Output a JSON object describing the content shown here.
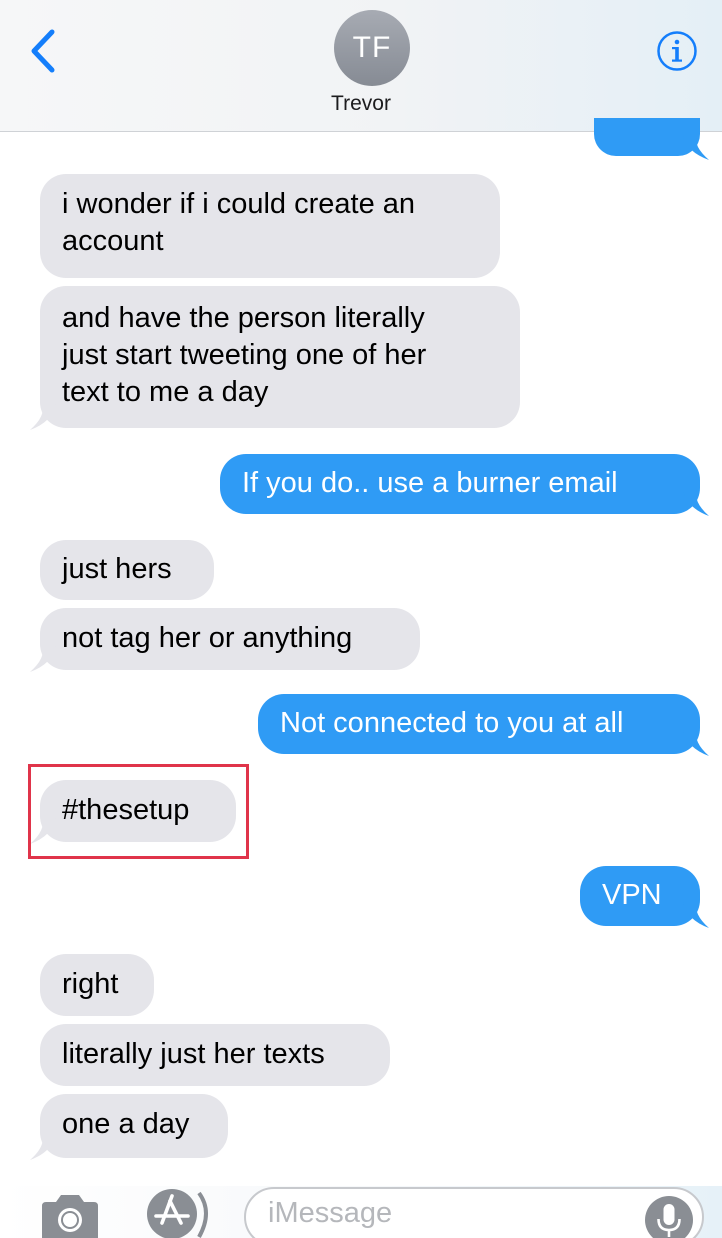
{
  "header": {
    "avatar_initials": "TF",
    "contact_name": "Trevor"
  },
  "messages": [
    {
      "direction": "in",
      "text": "i wonder if i could create an\naccount"
    },
    {
      "direction": "in",
      "text": "and have the person literally\njust start tweeting one of her\ntext to me a day"
    },
    {
      "direction": "out",
      "text": "If you do.. use a burner email"
    },
    {
      "direction": "in",
      "text": "just hers"
    },
    {
      "direction": "in",
      "text": "not tag her or anything"
    },
    {
      "direction": "out",
      "text": "Not connected to you at all"
    },
    {
      "direction": "in",
      "text": "#thesetup",
      "highlighted": true
    },
    {
      "direction": "out",
      "text": "VPN"
    },
    {
      "direction": "in",
      "text": "right"
    },
    {
      "direction": "in",
      "text": "literally just her texts"
    },
    {
      "direction": "in",
      "text": "one a day"
    }
  ],
  "input": {
    "placeholder": "iMessage"
  },
  "icons": {
    "back": "chevron-left-icon",
    "info": "info-icon",
    "camera": "camera-icon",
    "apps": "app-store-icon",
    "mic": "microphone-icon"
  },
  "colors": {
    "accent": "#147efb",
    "outgoing_bubble": "#2f9bf5",
    "incoming_bubble": "#e5e5ea",
    "highlight_box": "#e0344a"
  }
}
